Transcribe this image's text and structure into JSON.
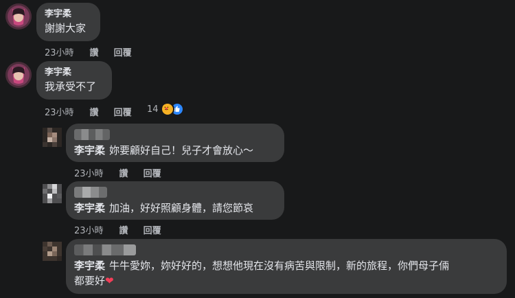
{
  "comments": [
    {
      "author": "李宇柔",
      "text": "謝謝大家",
      "time": "23小時",
      "like": "讚",
      "reply": "回覆"
    },
    {
      "author": "李宇柔",
      "text": "我承受不了",
      "time": "23小時",
      "like": "讚",
      "reply": "回覆",
      "reaction_count": "14"
    }
  ],
  "replies": [
    {
      "mention": "李宇柔",
      "text": "妳要顧好自己！兒子才會放心～",
      "time": "23小時",
      "like": "讚",
      "reply": "回覆"
    },
    {
      "mention": "李宇柔",
      "text": "加油，好好照顧身體，請您節哀",
      "time": "23小時",
      "like": "讚",
      "reply": "回覆"
    },
    {
      "mention": "李宇柔",
      "text_line1": "牛牛愛妳，妳好好的，想想他現在沒有病苦與限制，新的旅程，你們母子倆",
      "text_line2": "都要好"
    }
  ],
  "icons": {
    "care_reaction": "care-reaction-icon",
    "like_reaction": "like-reaction-icon",
    "heart": "heart-icon"
  },
  "colors": {
    "background": "#18191a",
    "bubble": "#3a3b3c",
    "like_blue": "#2d88ff",
    "heart_red": "#f33e58"
  }
}
